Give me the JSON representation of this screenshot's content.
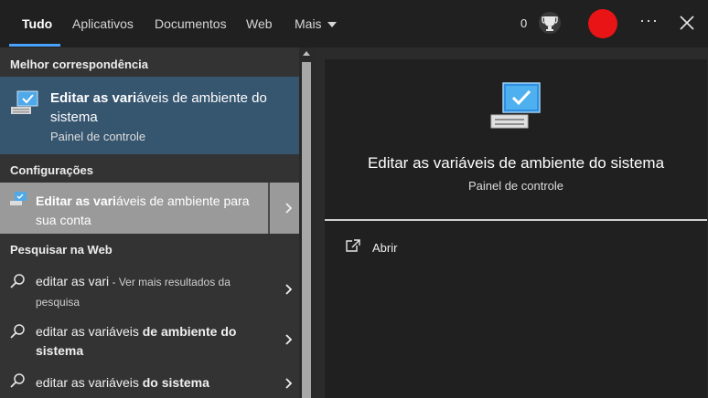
{
  "tabs": [
    {
      "label": "Tudo",
      "active": true
    },
    {
      "label": "Aplicativos"
    },
    {
      "label": "Documentos"
    },
    {
      "label": "Web"
    },
    {
      "label": "Mais"
    }
  ],
  "header": {
    "points": "0"
  },
  "sections": {
    "best_match": "Melhor correspondência",
    "settings": "Configurações",
    "web": "Pesquisar na Web"
  },
  "best_match": {
    "title_bold": "Editar as vari",
    "title_rest": "áveis de ambiente do sistema",
    "subtitle": "Painel de controle"
  },
  "setting_item": {
    "bold": "Editar as vari",
    "rest": "áveis de ambiente para sua conta"
  },
  "web_results": [
    {
      "plain": "editar as vari",
      "hint": " - Ver mais resultados da pesquisa"
    },
    {
      "plain": "editar as vari",
      "plain2": "áveis",
      "bold": " de ambiente do sistema"
    },
    {
      "plain": "editar as vari",
      "plain2": "áveis",
      "bold": " do sistema"
    }
  ],
  "preview": {
    "title": "Editar as variáveis de ambiente do sistema",
    "subtitle": "Painel de controle",
    "action_open": "Abrir"
  },
  "colors": {
    "accent": "#4aa3ff",
    "record": "#e81416",
    "selected": "#36556f"
  },
  "icons": [
    "trophy-icon",
    "more-icon",
    "close-icon",
    "computer-settings-icon",
    "search-icon",
    "chevron-right-icon",
    "open-external-icon"
  ]
}
